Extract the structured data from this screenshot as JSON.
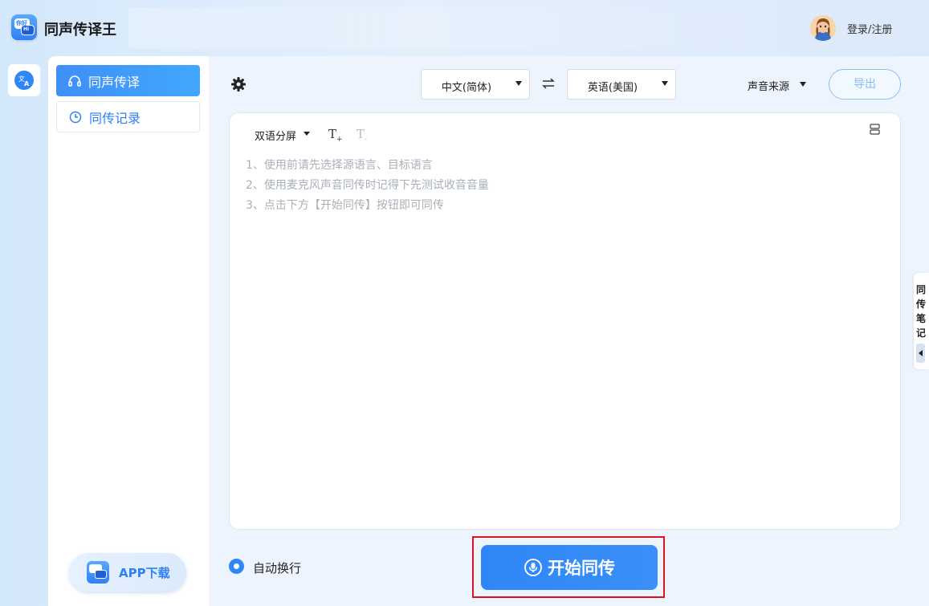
{
  "app": {
    "title": "同声传译王",
    "logo_text_top": "你好",
    "logo_text_bottom": "Hi",
    "login_label": "登录/注册"
  },
  "sidebar": {
    "items": [
      {
        "label": "同声传译",
        "icon": "headphones-icon",
        "active": true
      },
      {
        "label": "同传记录",
        "icon": "clock-icon",
        "active": false
      }
    ],
    "download_label": "APP下载"
  },
  "toolbar": {
    "source_lang": "中文(简体)",
    "target_lang": "英语(美国)",
    "audio_source_label": "声音来源",
    "export_label": "导出"
  },
  "editor": {
    "mode_label": "双语分屏",
    "font_increase": "T",
    "font_increase_mark": "+",
    "font_decrease": "T",
    "font_decrease_mark": "-",
    "hints": [
      "1、使用前请先选择源语言、目标语言",
      "2、使用麦克风声音同传时记得下先测试收音音量",
      "3、点击下方【开始同传】按钮即可同传"
    ]
  },
  "side_panel": {
    "chars": [
      "同",
      "传",
      "笔",
      "记"
    ]
  },
  "footer": {
    "auto_wrap_label": "自动换行",
    "auto_wrap_checked": true,
    "start_label": "开始同传"
  },
  "colors": {
    "accent": "#2f86f6",
    "highlight_frame": "#e0141e"
  }
}
